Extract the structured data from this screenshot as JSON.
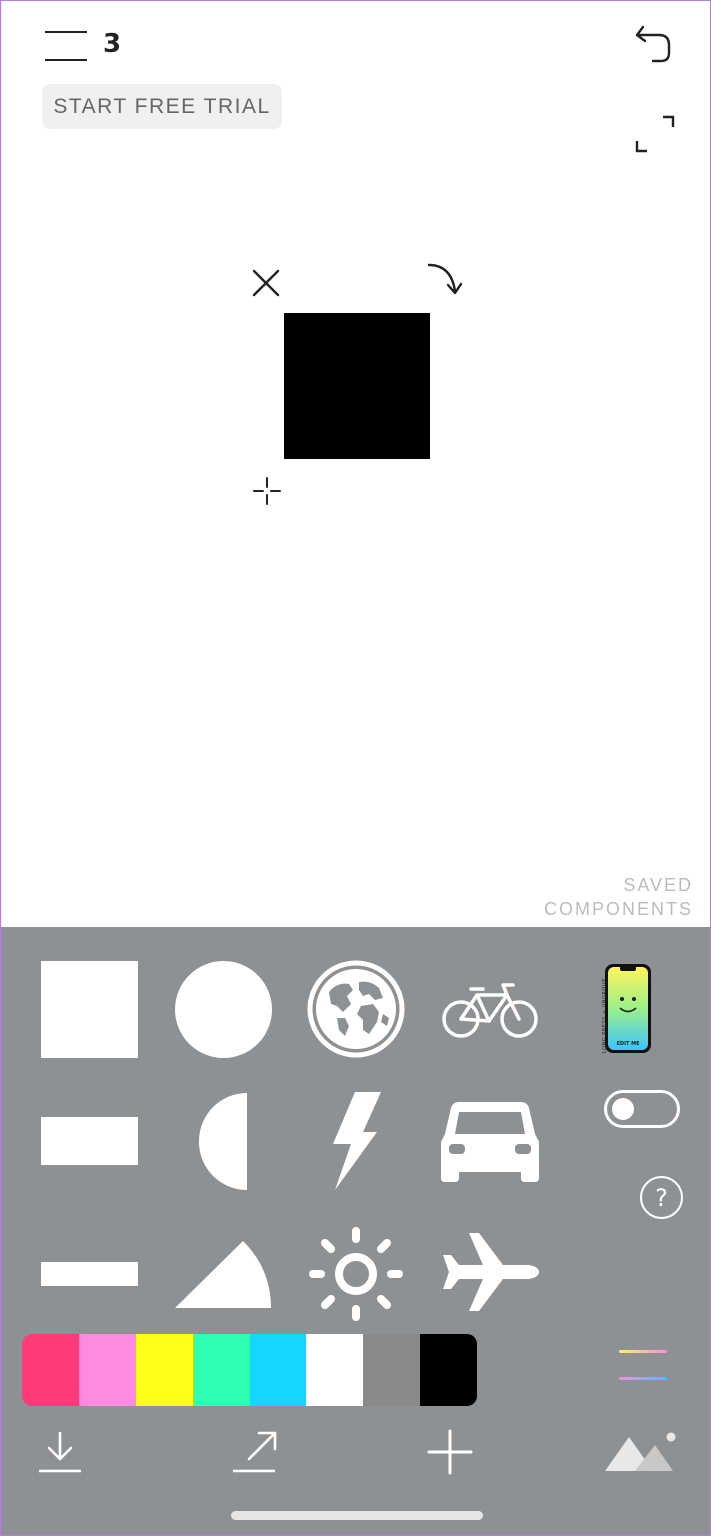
{
  "header": {
    "page_count": "3",
    "trial_label": "START FREE TRIAL"
  },
  "saved_components": {
    "line1": "SAVED",
    "line2": "COMPONENTS"
  },
  "phone_sticker": {
    "side_text": "LONG PRESS + UNGROUP",
    "edit_label": "EDIT ME"
  },
  "help": {
    "label": "?"
  },
  "palette": {
    "colors": [
      "#ff3b7a",
      "#ff8ae0",
      "#ffff1a",
      "#2effb2",
      "#14d6ff",
      "#ffffff",
      "#8a8a8a",
      "#000000"
    ]
  },
  "colors": {
    "panel": "#8e9194",
    "shape_fill": "#000000"
  }
}
